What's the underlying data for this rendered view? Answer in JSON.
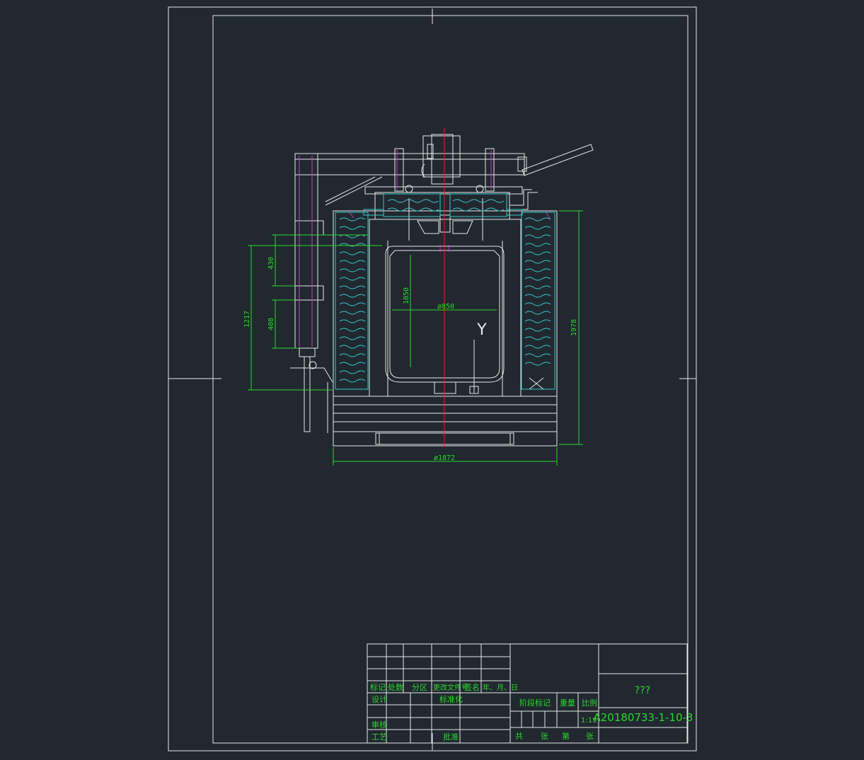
{
  "dimensions": {
    "d430": "430",
    "d408": "408",
    "d1217": "1217",
    "d1050": "1050",
    "d850": "ø850",
    "d1978": "1978",
    "d1872": "ø1872"
  },
  "view_label": "Y",
  "title_block": {
    "row_headers": [
      "标记",
      "处数",
      "分区",
      "更改文件号",
      "签名",
      "年、月、日"
    ],
    "design": "设计",
    "standardization": "标准化",
    "review": "审核",
    "process": "工艺",
    "approve": "批准",
    "stage_mark": "阶段标记",
    "weight": "重量",
    "ratio": "比例",
    "scale": "1:15",
    "drawing_name": "???",
    "drawing_number": "A20180733-1-10-3",
    "sheet_total": "共",
    "sheet_total_unit": "张",
    "sheet_no": "第",
    "sheet_no_unit": "张"
  },
  "colors": {
    "background": "#212830",
    "frame": "#e8e8e8",
    "dimension": "#2bd82b",
    "insulation": "#35c8c8",
    "center": "#e02020",
    "accent": "#c040c0"
  }
}
